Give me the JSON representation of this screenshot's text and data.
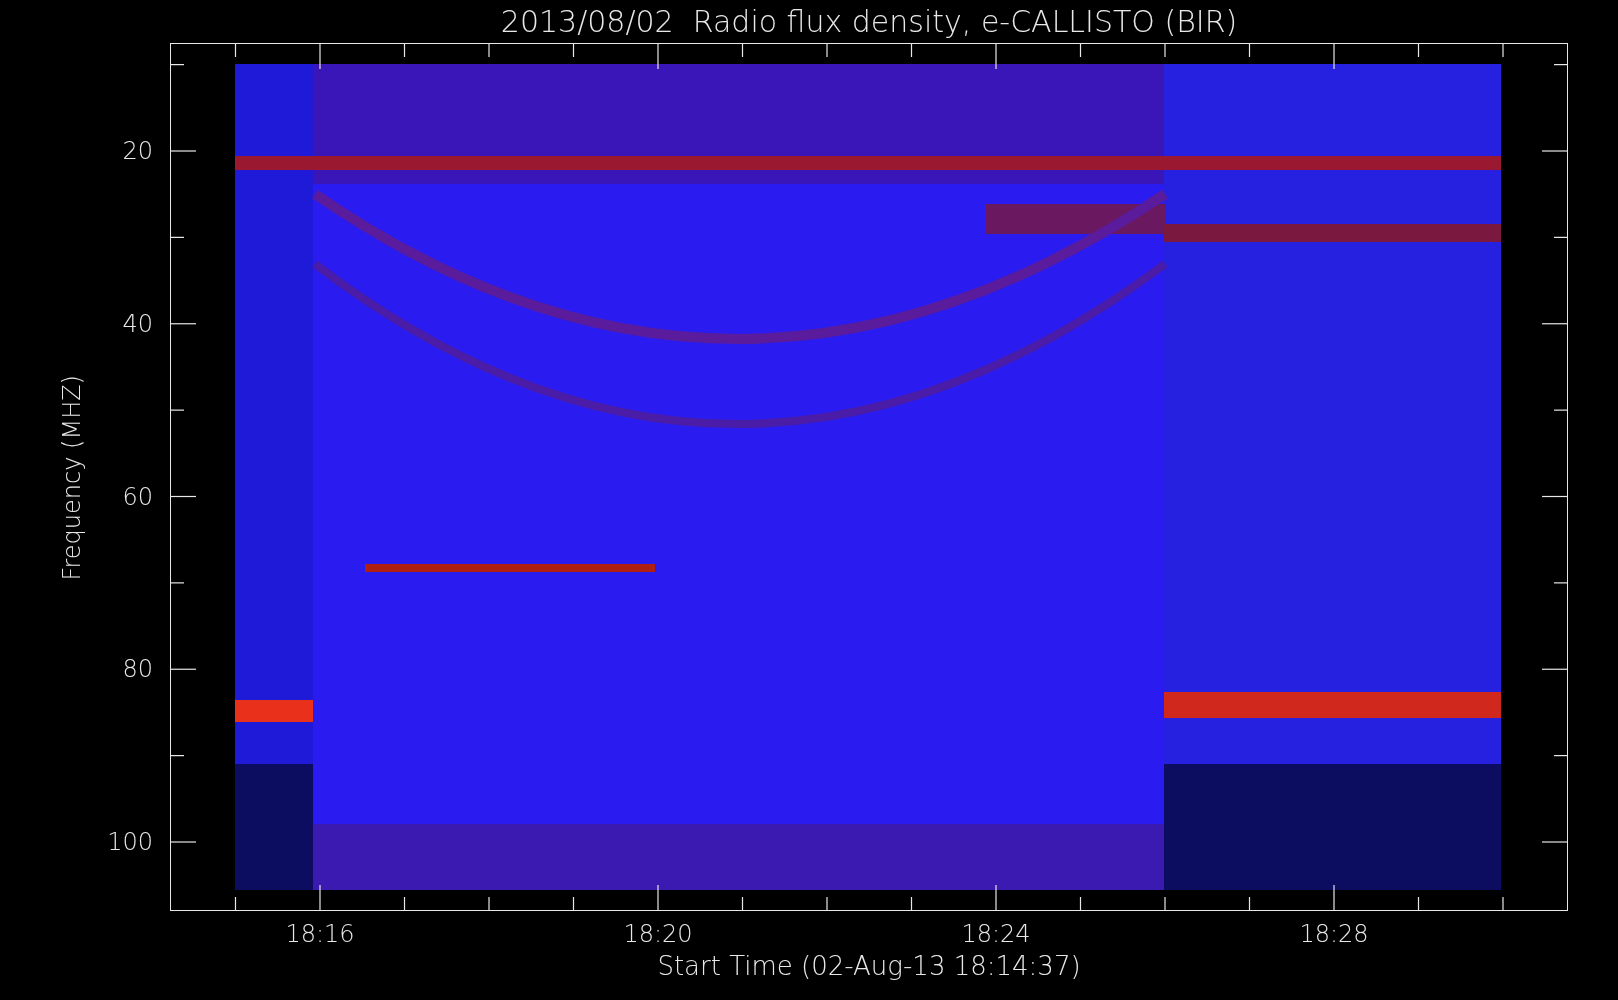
{
  "title": "2013/08/02  Radio flux density, e-CALLISTO (BIR)",
  "y_axis": {
    "label": "Frequency (MHZ)",
    "ticks": [
      "20",
      "40",
      "60",
      "80",
      "100"
    ]
  },
  "x_axis": {
    "label": "Start Time (02-Aug-13 18:14:37)",
    "ticks": [
      "18:16",
      "18:20",
      "18:24",
      "18:28"
    ]
  }
}
